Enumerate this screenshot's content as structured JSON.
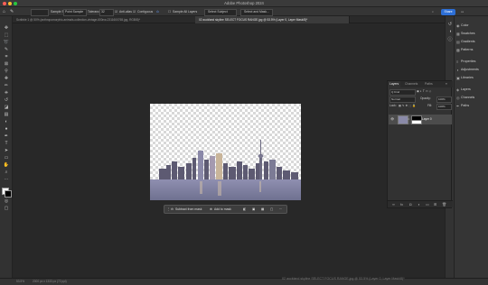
{
  "app": {
    "title": "Adobe Photoshop 2024"
  },
  "options_bar": {
    "sample_size_label": "Sample Size:",
    "sample_size_value": "Point Sample",
    "tolerance_label": "Tolerance:",
    "tolerance_value": "32",
    "anti_alias_label": "Anti-alias",
    "contiguous_label": "Contiguous",
    "sample_all_label": "Sample All Layers",
    "select_subject_label": "Select Subject",
    "select_and_mask_label": "Select and Mask...",
    "share_label": "Share"
  },
  "tabs": [
    {
      "label": "Scribble 1 @ 50% (anthropomorphic-animals-collection-vintage-600nw-2311600765.jpg, RGB/8)*"
    },
    {
      "label": "02 auckland skyline SELECT FOCUS RANGE.jpg @ 53.5% (Layer 0, Layer Mask/8)*"
    }
  ],
  "contextual_taskbar": {
    "subtract_label": "Subtract from mask",
    "add_label": "Add to mask",
    "more_label": "···"
  },
  "right_panel": {
    "items": [
      {
        "label": "Color",
        "icon": "color-wheel-icon"
      },
      {
        "label": "Swatches",
        "icon": "swatches-icon"
      },
      {
        "label": "Gradients",
        "icon": "gradient-icon"
      },
      {
        "label": "Patterns",
        "icon": "pattern-icon"
      },
      {
        "label": "Properties",
        "icon": "properties-icon"
      },
      {
        "label": "Adjustments",
        "icon": "adjustments-icon"
      },
      {
        "label": "Libraries",
        "icon": "libraries-icon"
      },
      {
        "label": "Layers",
        "icon": "layers-icon"
      },
      {
        "label": "Channels",
        "icon": "channels-icon"
      },
      {
        "label": "Paths",
        "icon": "paths-icon"
      }
    ]
  },
  "layers_panel": {
    "tabs": [
      "Layers",
      "Channels",
      "Paths"
    ],
    "filter_label": "Q Kind",
    "blend_mode": "Normal",
    "opacity_label": "Opacity:",
    "opacity_value": "100%",
    "lock_label": "Lock:",
    "fill_label": "Fill:",
    "fill_value": "100%",
    "layer_name": "Layer 0"
  },
  "status_bar": {
    "zoom": "53.5%",
    "doc_size": "2000 px x 1333 px (72 ppi)"
  },
  "bottom_doc_title": "02 auckland skyline SELECT FOCUS RANGE.jpg @ 53.5% (Layer 0, Layer Mask/8)*"
}
